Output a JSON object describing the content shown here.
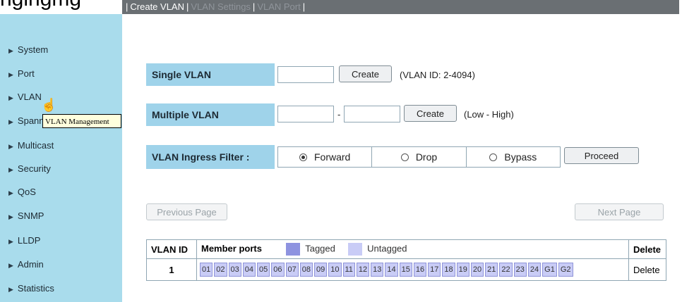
{
  "top_heading": "ngingmg",
  "tabs": [
    {
      "label": "Create VLAN",
      "active": true
    },
    {
      "label": "VLAN Settings",
      "active": false
    },
    {
      "label": "VLAN Port",
      "active": false
    }
  ],
  "tab_separator": "|",
  "sidebar": {
    "items": [
      {
        "label": "System"
      },
      {
        "label": "Port"
      },
      {
        "label": "VLAN"
      },
      {
        "label": "Spanning Tree"
      },
      {
        "label": "Multicast"
      },
      {
        "label": "Security"
      },
      {
        "label": "QoS"
      },
      {
        "label": "SNMP"
      },
      {
        "label": "LLDP"
      },
      {
        "label": "Admin"
      },
      {
        "label": "Statistics"
      }
    ],
    "tooltip": "VLAN Management"
  },
  "single_vlan": {
    "label": "Single VLAN",
    "value": "",
    "button": "Create",
    "hint": "(VLAN ID: 2-4094)"
  },
  "multiple_vlan": {
    "label": "Multiple VLAN",
    "from_value": "",
    "dash": "-",
    "to_value": "",
    "button": "Create",
    "hint": "(Low - High)"
  },
  "ingress_filter": {
    "label": "VLAN Ingress Filter :",
    "options": [
      {
        "label": "Forward",
        "selected": true
      },
      {
        "label": "Drop",
        "selected": false
      },
      {
        "label": "Bypass",
        "selected": false
      }
    ],
    "button": "Proceed"
  },
  "paging": {
    "previous": "Previous Page",
    "next": "Next Page"
  },
  "table": {
    "headers": {
      "vlan_id": "VLAN ID",
      "member_ports": "Member ports",
      "tagged": "Tagged",
      "untagged": "Untagged",
      "delete": "Delete"
    },
    "rows": [
      {
        "vlan_id": "1",
        "ports": [
          "01",
          "02",
          "03",
          "04",
          "05",
          "06",
          "07",
          "08",
          "09",
          "10",
          "11",
          "12",
          "13",
          "14",
          "15",
          "16",
          "17",
          "18",
          "19",
          "20",
          "21",
          "22",
          "23",
          "24",
          "G1",
          "G2"
        ],
        "delete": "Delete"
      }
    ]
  },
  "colors": {
    "sidebar_bg": "#a9dcec",
    "label_bg": "#9fd3ea",
    "tab_bar": "#6a6f73",
    "tagged": "#8e93e0",
    "untagged": "#c9ccf6"
  }
}
